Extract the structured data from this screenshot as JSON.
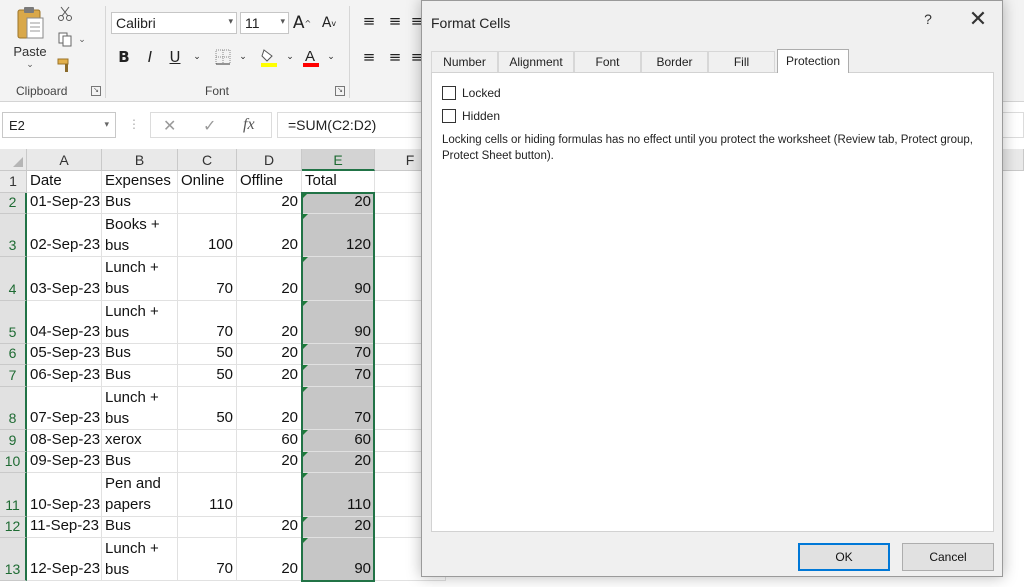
{
  "ribbon": {
    "paste_label": "Paste",
    "clipboard_label": "Clipboard",
    "font_group_label": "Font",
    "font_name": "Calibri",
    "font_size": "11",
    "bold": "B",
    "italic": "I",
    "underline": "U",
    "grow_font": "A",
    "shrink_font": "A",
    "fill_color": "#ffff00",
    "font_color": "#ff0000"
  },
  "formula_bar": {
    "name_box": "E2",
    "cancel_glyph": "✕",
    "enter_glyph": "✓",
    "fx_label": "fx",
    "formula": "=SUM(C2:D2)"
  },
  "grid": {
    "columns": [
      "A",
      "B",
      "C",
      "D",
      "E",
      "F"
    ],
    "selected_column": "E",
    "rows": [
      {
        "num": "1",
        "a": "Date",
        "b": "Expenses",
        "c": "Online",
        "d": "Offline",
        "e": "Total"
      },
      {
        "num": "2",
        "a": "01-Sep-23",
        "b": "Bus",
        "c": "",
        "d": "20",
        "e": "20"
      },
      {
        "num": "3",
        "a": "02-Sep-23",
        "b": "Books + bus",
        "c": "100",
        "d": "20",
        "e": "120"
      },
      {
        "num": "4",
        "a": "03-Sep-23",
        "b": "Lunch + bus",
        "c": "70",
        "d": "20",
        "e": "90"
      },
      {
        "num": "5",
        "a": "04-Sep-23",
        "b": "Lunch + bus",
        "c": "70",
        "d": "20",
        "e": "90"
      },
      {
        "num": "6",
        "a": "05-Sep-23",
        "b": "Bus",
        "c": "50",
        "d": "20",
        "e": "70"
      },
      {
        "num": "7",
        "a": "06-Sep-23",
        "b": "Bus",
        "c": "50",
        "d": "20",
        "e": "70"
      },
      {
        "num": "8",
        "a": "07-Sep-23",
        "b": "Lunch + bus",
        "c": "50",
        "d": "20",
        "e": "70"
      },
      {
        "num": "9",
        "a": "08-Sep-23",
        "b": "xerox",
        "c": "",
        "d": "60",
        "e": "60"
      },
      {
        "num": "10",
        "a": "09-Sep-23",
        "b": "Bus",
        "c": "",
        "d": "20",
        "e": "20"
      },
      {
        "num": "11",
        "a": "10-Sep-23",
        "b": "Pen and papers",
        "c": "110",
        "d": "",
        "e": "110"
      },
      {
        "num": "12",
        "a": "11-Sep-23",
        "b": "Bus",
        "c": "",
        "d": "20",
        "e": "20"
      },
      {
        "num": "13",
        "a": "12-Sep-23",
        "b": "Lunch + bus",
        "c": "70",
        "d": "20",
        "e": "90"
      }
    ]
  },
  "dialog": {
    "title": "Format Cells",
    "help": "?",
    "close": "✕",
    "tabs": [
      "Number",
      "Alignment",
      "Font",
      "Border",
      "Fill",
      "Protection"
    ],
    "active_tab": "Protection",
    "locked_label": "Locked",
    "locked_checked": false,
    "hidden_label": "Hidden",
    "hidden_checked": false,
    "note": "Locking cells or hiding formulas has no effect until you protect the worksheet (Review tab, Protect group, Protect Sheet button).",
    "ok_label": "OK",
    "cancel_label": "Cancel"
  }
}
